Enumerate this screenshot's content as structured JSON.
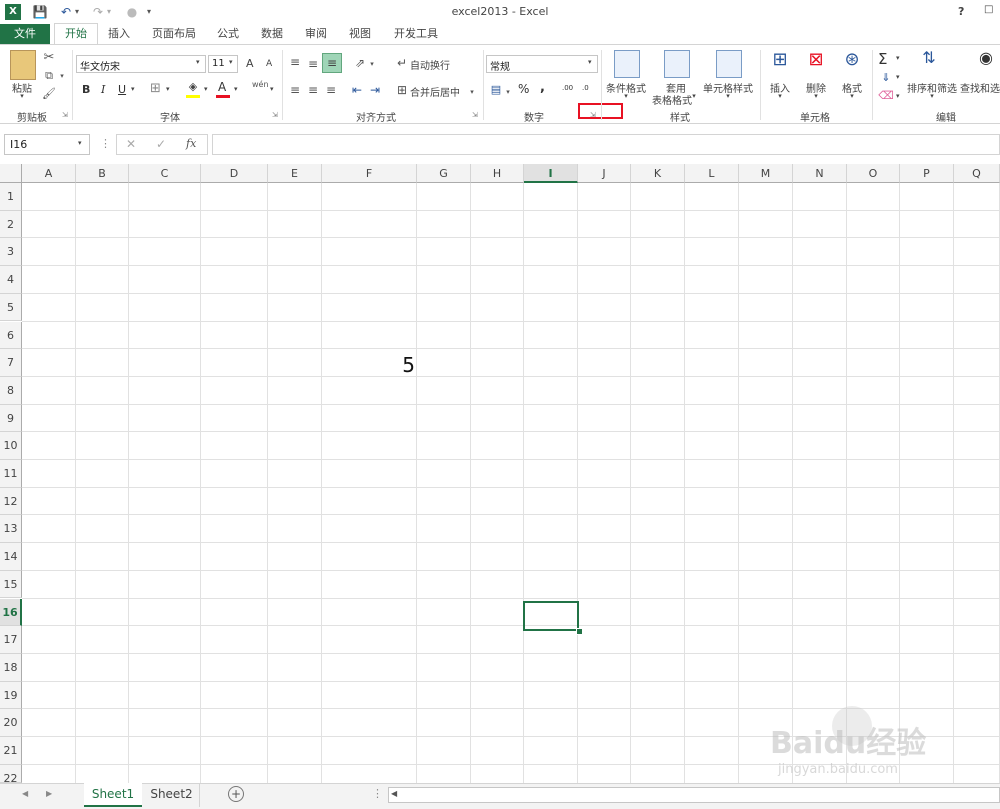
{
  "window": {
    "title": "excel2013 - Excel",
    "help": "?"
  },
  "tabs": [
    "文件",
    "开始",
    "插入",
    "页面布局",
    "公式",
    "数据",
    "审阅",
    "视图",
    "开发工具"
  ],
  "ribbon": {
    "clipboard": {
      "paste": "粘贴",
      "label": "剪贴板"
    },
    "font": {
      "name": "华文仿宋",
      "size": "11",
      "bold": "B",
      "italic": "I",
      "underline": "U",
      "grow": "A",
      "shrink": "A",
      "font_color": "A",
      "phonetic": "wén",
      "label": "字体"
    },
    "alignment": {
      "wrap": "自动换行",
      "merge": "合并后居中",
      "label": "对齐方式"
    },
    "number": {
      "format": "常规",
      "percent": "%",
      "comma": ",",
      "inc_dec": ".00",
      "dec_dec": ".0",
      "label": "数字"
    },
    "styles": {
      "conditional": "条件格式",
      "table1": "套用",
      "table2": "表格格式",
      "cell_styles": "单元格样式",
      "label": "样式"
    },
    "cells": {
      "insert": "插入",
      "delete": "删除",
      "format": "格式",
      "label": "单元格"
    },
    "editing": {
      "sum": "Σ",
      "sort": "排序和筛选",
      "find": "查找和选",
      "label": "编辑"
    }
  },
  "formula_bar": {
    "name_box": "I16",
    "fx": "fx",
    "cancel": "✕",
    "enter": "✓",
    "formula": ""
  },
  "columns": [
    "A",
    "B",
    "C",
    "D",
    "E",
    "F",
    "G",
    "H",
    "I",
    "J",
    "K",
    "L",
    "M",
    "N",
    "O",
    "P",
    "Q"
  ],
  "rows": [
    "1",
    "2",
    "3",
    "4",
    "5",
    "6",
    "7",
    "8",
    "9",
    "10",
    "11",
    "12",
    "13",
    "14",
    "15",
    "16",
    "17",
    "18",
    "19",
    "20",
    "21",
    "22"
  ],
  "cells": {
    "f7_value": "5"
  },
  "selected_cell": "I16",
  "sheets": {
    "sheet1": "Sheet1",
    "sheet2": "Sheet2",
    "add": "+"
  },
  "watermark": {
    "brand": "Baidu经验",
    "url": "jingyan.baidu.com"
  },
  "colors": {
    "excel_green": "#217346",
    "highlight_red": "#e81123"
  }
}
